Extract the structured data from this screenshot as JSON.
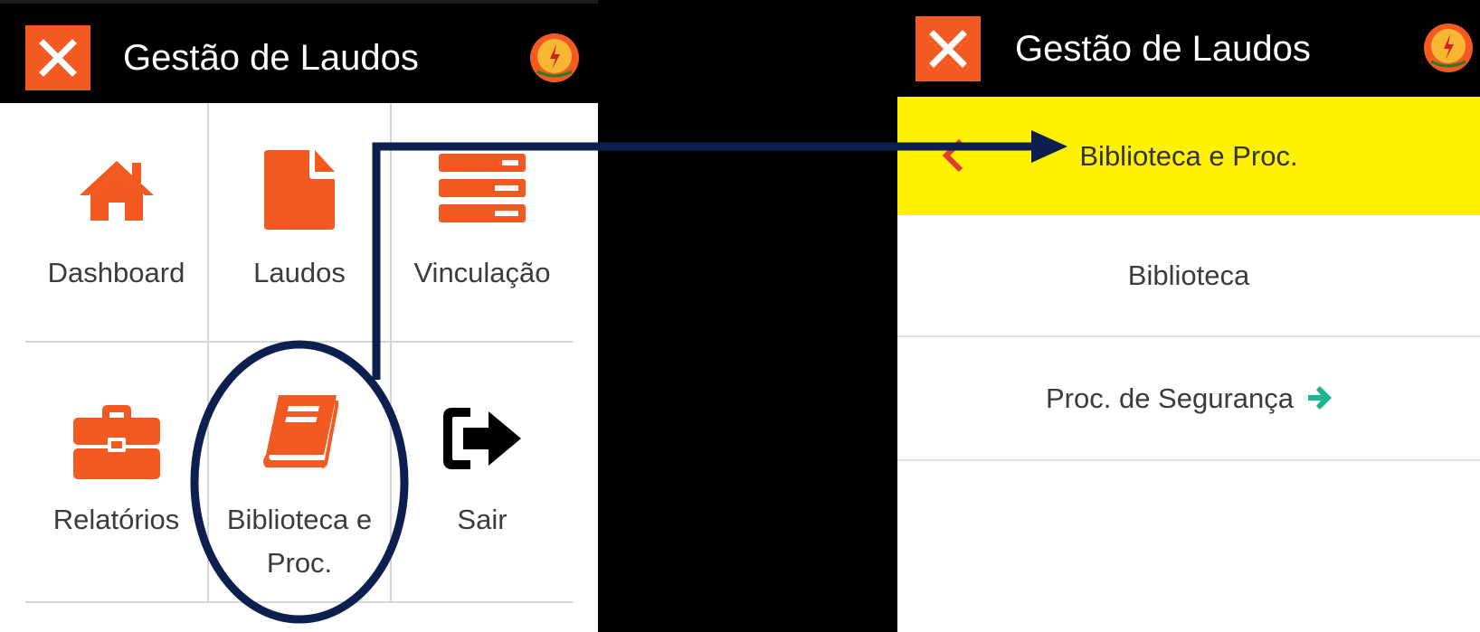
{
  "app": {
    "title": "Gestão de Laudos"
  },
  "left_screen": {
    "menu_items": [
      {
        "label": "Dashboard",
        "icon": "home-icon"
      },
      {
        "label": "Laudos",
        "icon": "document-icon"
      },
      {
        "label": "Vinculação",
        "icon": "server-icon"
      },
      {
        "label": "Relatórios",
        "icon": "briefcase-icon"
      },
      {
        "label": "Biblioteca e Proc.",
        "label_line1": "Biblioteca e",
        "label_line2": "Proc.",
        "icon": "book-icon"
      },
      {
        "label": "Sair",
        "icon": "sign-out-icon"
      }
    ]
  },
  "right_screen": {
    "header": "Biblioteca e Proc.",
    "items": [
      {
        "label": "Biblioteca"
      },
      {
        "label": "Proc. de Segurança",
        "icon": "arrow-right-icon"
      }
    ]
  },
  "colors": {
    "accent": "#f25a22",
    "highlight": "#fff200",
    "annotation": "#0d1f4f",
    "arrow_green": "#1fb58f"
  }
}
